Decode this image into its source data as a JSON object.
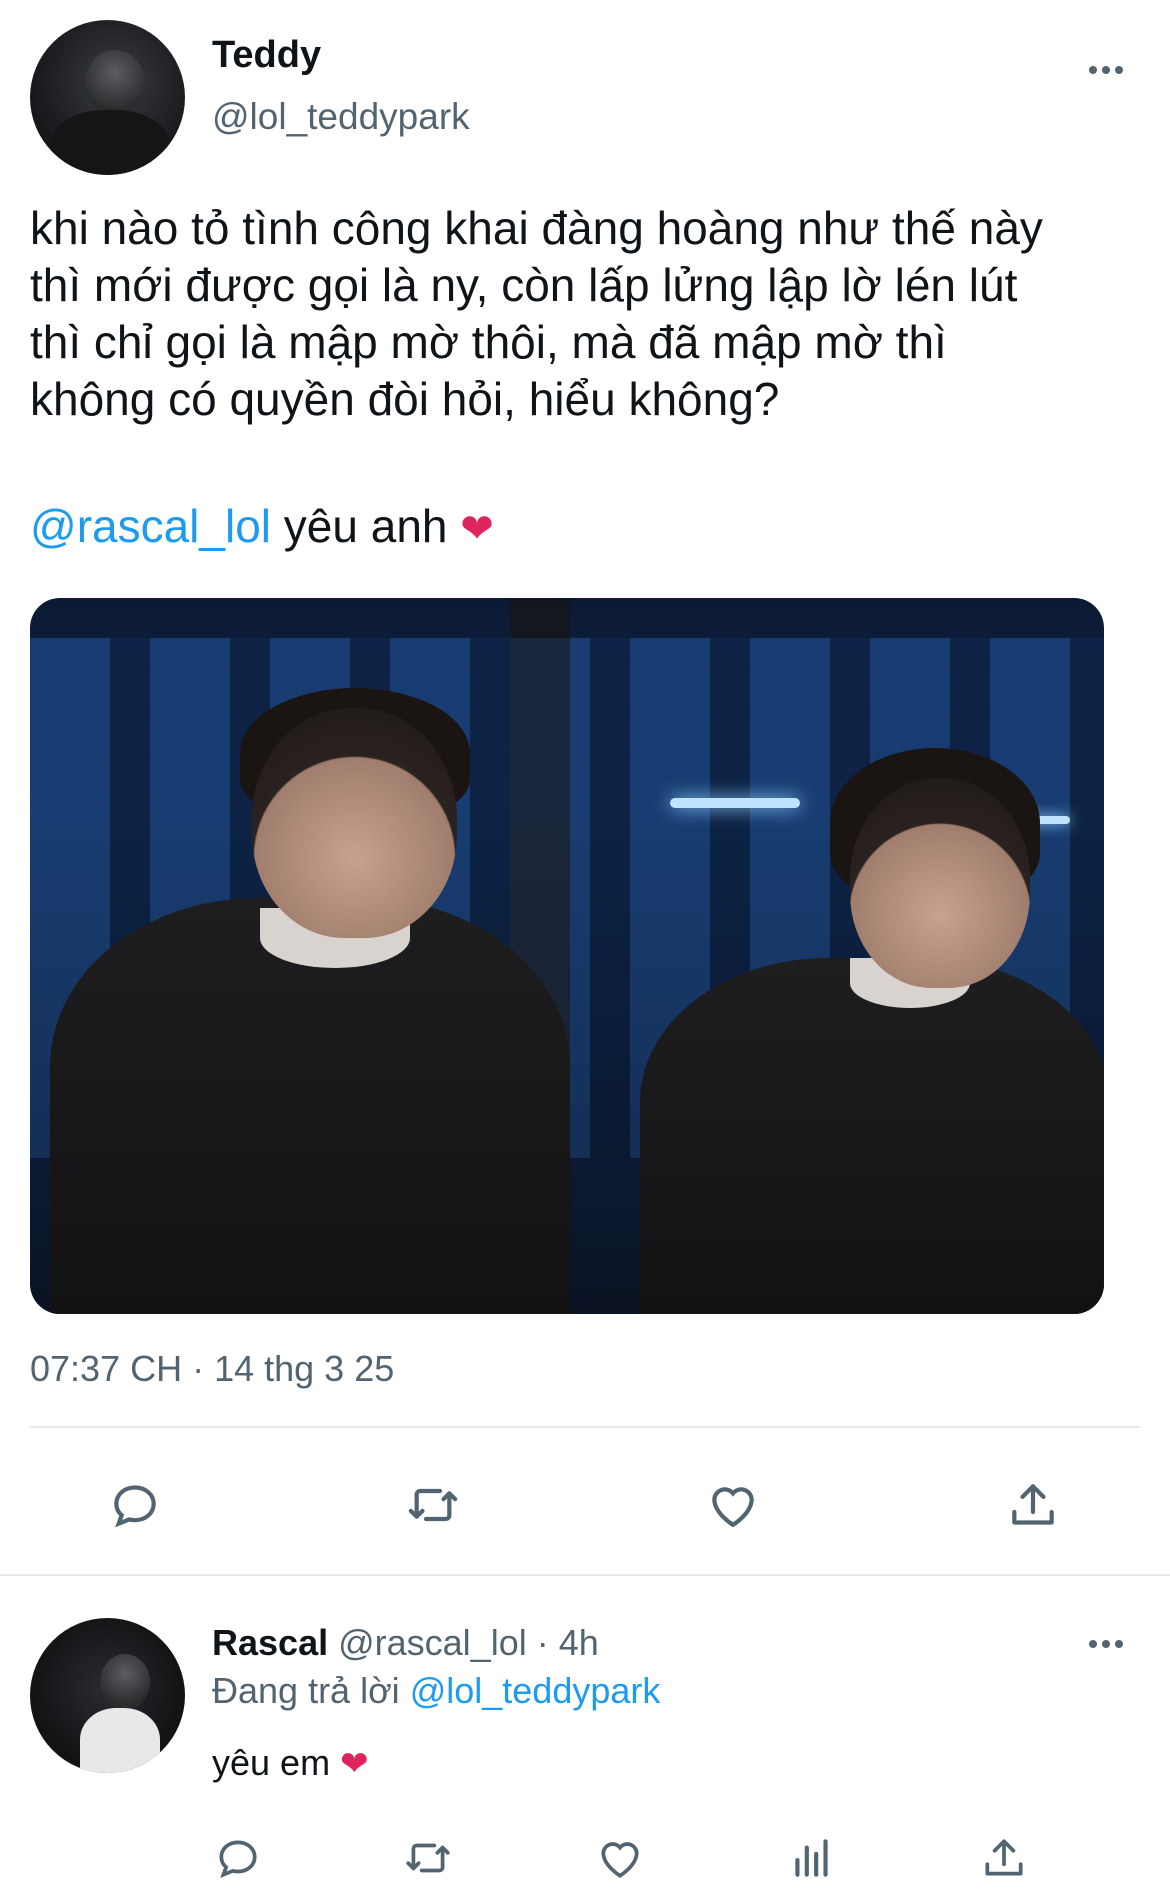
{
  "tweet": {
    "author_name": "Teddy",
    "author_handle": "@lol_teddypark",
    "text_lines": [
      "khi nào tỏ tình công khai đàng hoàng như thế này",
      "thì mới được gọi là ny, còn lấp lửng lập lờ lén lút",
      "thì chỉ gọi là mập mờ thôi, mà đã mập mờ thì",
      "không có quyền đòi hỏi, hiểu không?"
    ],
    "mention": "@rascal_lol",
    "mention_suffix": " yêu anh",
    "emoji": "❤",
    "timestamp": "07:37 CH · 14 thg 3 25",
    "actions": [
      "reply-icon",
      "retweet-icon",
      "like-icon",
      "share-icon"
    ]
  },
  "reply": {
    "author_name": "Rascal",
    "author_handle": "@rascal_lol",
    "time": "· 4h",
    "replying_prefix": "Đang trả lời ",
    "replying_to": "@lol_teddypark",
    "text": "yêu em ",
    "emoji": "❤",
    "actions": [
      "reply-icon",
      "retweet-icon",
      "like-icon",
      "analytics-icon",
      "share-icon"
    ]
  },
  "colors": {
    "accent": "#1d9bf0",
    "secondary_text": "#536471",
    "heart": "#e0245e",
    "divider": "#e7e9ea"
  }
}
